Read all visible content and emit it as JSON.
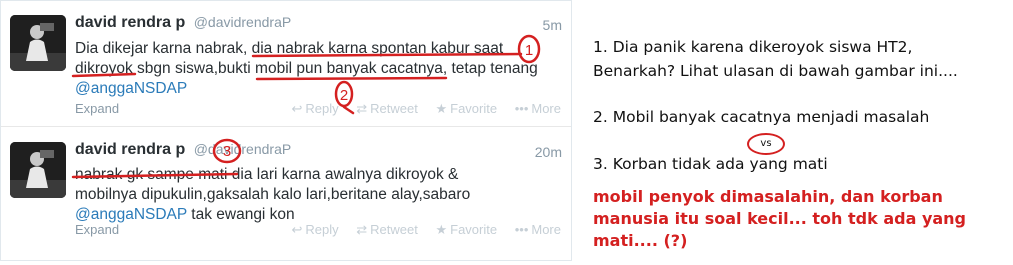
{
  "tweets": [
    {
      "name": "david rendra p",
      "handle": "@davidrendraP",
      "time": "5m",
      "lines": [
        "Dia dikejar karna nabrak, dia nabrak karna spontan kabur saat",
        "dikroyok sbgn siswa,bukti mobil pun banyak cacatnya, tetap tenang"
      ],
      "mention": "@anggaNSDAP",
      "after_mention": "",
      "expand": "Expand",
      "actions": {
        "reply": "Reply",
        "retweet": "Retweet",
        "favorite": "Favorite",
        "more": "More"
      }
    },
    {
      "name": "david rendra p",
      "handle": "@davidrendraP",
      "time": "20m",
      "lines": [
        "nabrak gk sampe mati dia lari karna awalnya dikroyok &",
        "mobilnya dipukulin,gaksalah kalo lari,beritane alay,sabaro"
      ],
      "mention": "@anggaNSDAP",
      "after_mention": " tak ewangi kon",
      "expand": "Expand",
      "actions": {
        "reply": "Reply",
        "retweet": "Retweet",
        "favorite": "Favorite",
        "more": "More"
      }
    }
  ],
  "annotations": {
    "mark1": "1",
    "mark2": "2",
    "mark3": "3",
    "annotation_color": "#d42020"
  },
  "points": {
    "p1_line1": "1. Dia panik karena dikeroyok siswa HT2,",
    "p1_line2": "Benarkah?  Lihat ulasan di bawah gambar ini....",
    "p2": "2. Mobil banyak cacatnya menjadi masalah",
    "vs": "vs",
    "p3": "3. Korban tidak ada yang mati"
  },
  "commentary": "mobil penyok dimasalahin, dan korban manusia itu soal kecil... toh tdk ada yang mati.... (?)",
  "colors": {
    "mention": "#2b7bb9",
    "muted": "#8899a6",
    "text": "#292f33",
    "commentary": "#d42020"
  }
}
